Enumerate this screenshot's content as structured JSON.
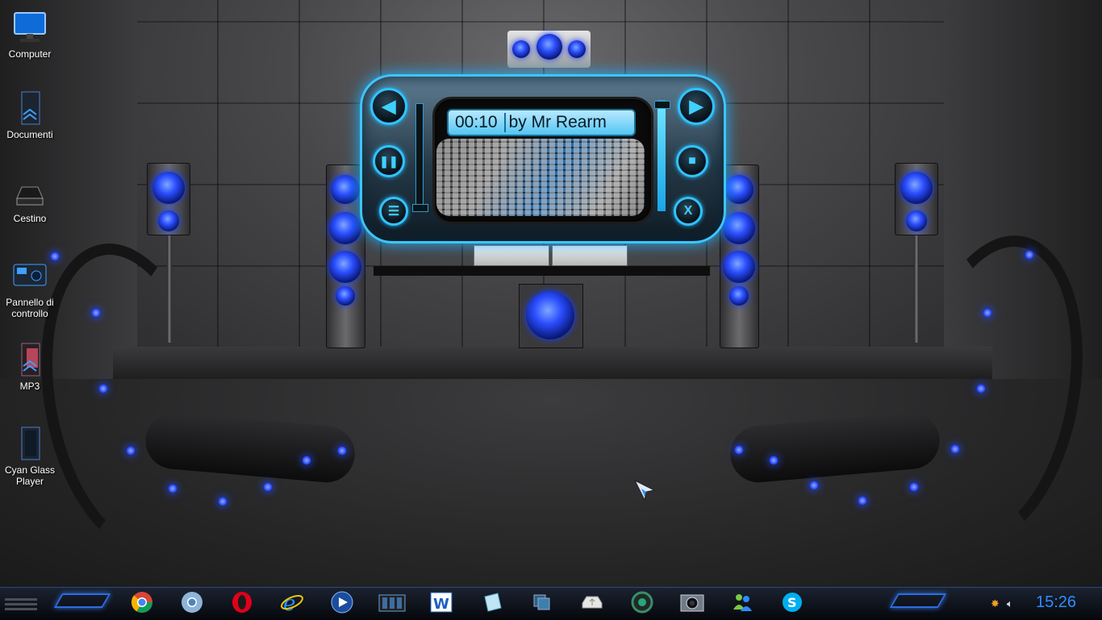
{
  "desktop": {
    "icons": [
      {
        "label": "Computer",
        "icon": "monitor-icon"
      },
      {
        "label": "Documenti",
        "icon": "documents-folder-icon"
      },
      {
        "label": "Cestino",
        "icon": "recycle-bin-icon"
      },
      {
        "label": "Pannello di controllo",
        "icon": "control-panel-icon"
      },
      {
        "label": "MP3",
        "icon": "mp3-folder-icon"
      },
      {
        "label": "Cyan Glass Player",
        "icon": "cyan-glass-player-icon"
      }
    ]
  },
  "player": {
    "time": "00:10",
    "title": "by Mr  Rearm",
    "buttons": {
      "prev": "◀",
      "next": "▶",
      "pause": "❚❚",
      "stop": "■",
      "menu": "☰",
      "close": "X"
    },
    "seek_fraction": 0.0,
    "volume_fraction": 0.97,
    "accent_color": "#30c3ff"
  },
  "taskbar": {
    "apps": [
      {
        "name": "chrome",
        "icon": "chrome-icon"
      },
      {
        "name": "chromium",
        "icon": "chromium-icon"
      },
      {
        "name": "opera",
        "icon": "opera-icon"
      },
      {
        "name": "internet-explorer",
        "icon": "internet-explorer-icon"
      },
      {
        "name": "media-player",
        "icon": "media-player-icon"
      },
      {
        "name": "film-strip",
        "icon": "film-icon"
      },
      {
        "name": "word",
        "icon": "word-icon"
      },
      {
        "name": "notes",
        "icon": "notes-icon"
      },
      {
        "name": "windows-explorer",
        "icon": "windows-explorer-icon"
      },
      {
        "name": "usb-drive",
        "icon": "usb-drive-icon"
      },
      {
        "name": "gear-app",
        "icon": "gear-app-icon"
      },
      {
        "name": "camera",
        "icon": "camera-icon"
      },
      {
        "name": "messenger",
        "icon": "messenger-icon"
      },
      {
        "name": "skype",
        "icon": "skype-icon"
      }
    ],
    "clock": "15:26",
    "clock_color": "#2f8cff"
  }
}
